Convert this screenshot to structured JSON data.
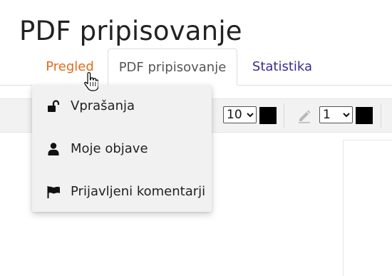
{
  "page": {
    "title": "PDF pripisovanje"
  },
  "tabs": [
    {
      "label": "Pregled",
      "color": "#e06c1a"
    },
    {
      "label": "PDF pripisovanje",
      "active": true
    },
    {
      "label": "Statistika",
      "color": "#3d2a8c"
    }
  ],
  "toolbar": {
    "font_size": {
      "value": "10"
    },
    "font_color": "#000000",
    "line_width": {
      "value": "1"
    },
    "line_color": "#000000"
  },
  "dropdown": {
    "items": [
      {
        "label": "Vprašanja",
        "icon": "unlock-icon"
      },
      {
        "label": "Moje objave",
        "icon": "user-icon"
      },
      {
        "label": "Prijavljeni komentarji",
        "icon": "flag-icon"
      }
    ]
  }
}
